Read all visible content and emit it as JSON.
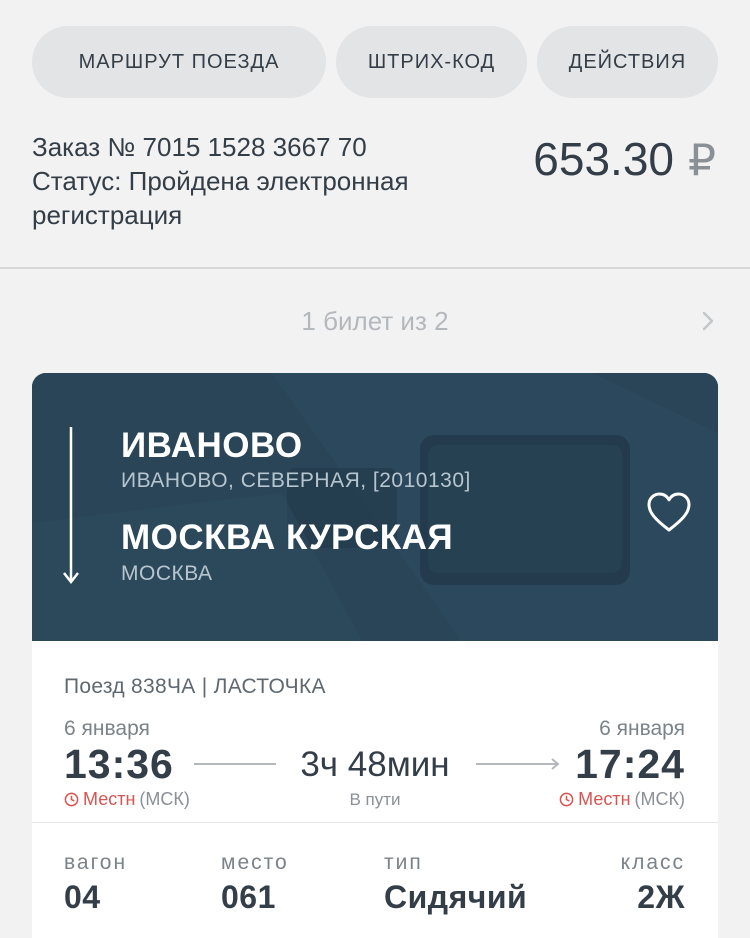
{
  "actions": {
    "route_label": "МАРШРУТ ПОЕЗДА",
    "barcode_label": "ШТРИХ-КОД",
    "actions_label": "ДЕЙСТВИЯ"
  },
  "order": {
    "number_line": "Заказ № 7015 1528 3667 70",
    "status_line": "Статус: Пройдена электронная регистрация",
    "price": "653.30",
    "currency": "₽"
  },
  "pager": {
    "text": "1 билет из 2",
    "next_icon": "chevron-right-icon"
  },
  "ticket": {
    "from_station": "ИВАНОВО",
    "from_sub": "ИВАНОВО, СЕВЕРНАЯ, [2010130]",
    "to_station": "МОСКВА КУРСКАЯ",
    "to_sub": "МОСКВА",
    "favorite_icon": "heart-icon",
    "train_line": "Поезд 838ЧА | ЛАСТОЧКА",
    "departure": {
      "date": "6 января",
      "time": "13:36",
      "tz_label": "Местн",
      "tz_suffix": "(МСК)"
    },
    "arrival": {
      "date": "6 января",
      "time": "17:24",
      "tz_label": "Местн",
      "tz_suffix": "(МСК)"
    },
    "duration": "3ч 48мин",
    "duration_label": "В пути",
    "details": {
      "car_label": "вагон",
      "car_value": "04",
      "seat_label": "место",
      "seat_value": "061",
      "type_label": "тип",
      "type_value": "Сидячий",
      "class_label": "класс",
      "class_value": "2Ж"
    }
  },
  "colors": {
    "text": "#333e48",
    "pill_bg": "#e3e4e6",
    "hero_bg": "#2d4a5c",
    "accent_red": "#d9534f"
  }
}
